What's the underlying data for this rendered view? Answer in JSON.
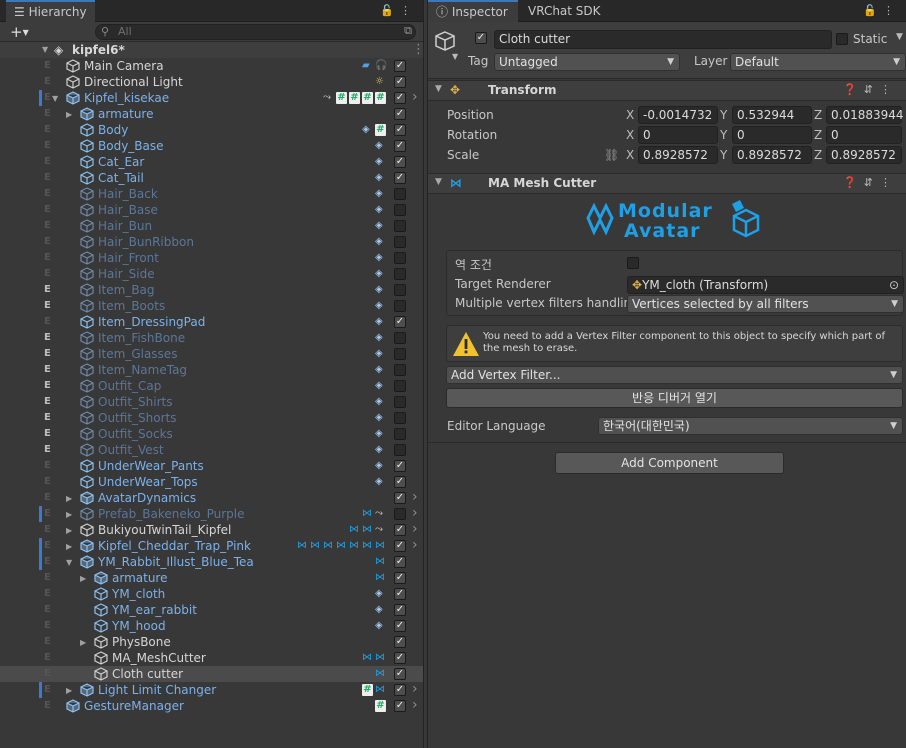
{
  "hierarchy": {
    "tab": "Hierarchy",
    "search_placeholder": "All",
    "scene": "kipfel6*",
    "rows": [
      {
        "label": "Main Camera",
        "color": "white",
        "depth": 0,
        "icons": [
          "camera-icon",
          "audio-listener-icon"
        ],
        "chk": true
      },
      {
        "label": "Directional Light",
        "color": "white",
        "depth": 0,
        "icons": [
          "light-icon"
        ],
        "chk": true
      },
      {
        "label": "Kipfel_kisekae",
        "color": "blue",
        "depth": 0,
        "arrow": "down",
        "bar": true,
        "icons": [
          "constraint-icon",
          "script-icon",
          "script-icon",
          "script-icon",
          "script-icon"
        ],
        "chk": true,
        "more": true
      },
      {
        "label": "armature",
        "color": "blue",
        "depth": 1,
        "arrow": "right",
        "chk": true
      },
      {
        "label": "Body",
        "color": "blue",
        "depth": 1,
        "icons": [
          "mesh-renderer-icon",
          "script-icon"
        ],
        "chk": true
      },
      {
        "label": "Body_Base",
        "color": "blue",
        "depth": 1,
        "icons": [
          "mesh-renderer-icon"
        ],
        "chk": true
      },
      {
        "label": "Cat_Ear",
        "color": "blue",
        "depth": 1,
        "icons": [
          "mesh-renderer-icon"
        ],
        "chk": true
      },
      {
        "label": "Cat_Tail",
        "color": "blue",
        "depth": 1,
        "icons": [
          "mesh-renderer-icon"
        ],
        "chk": true
      },
      {
        "label": "Hair_Back",
        "color": "dim",
        "depth": 1,
        "icons": [
          "mesh-renderer-icon"
        ],
        "chk": false
      },
      {
        "label": "Hair_Base",
        "color": "dim",
        "depth": 1,
        "icons": [
          "mesh-renderer-icon"
        ],
        "chk": false
      },
      {
        "label": "Hair_Bun",
        "color": "dim",
        "depth": 1,
        "icons": [
          "mesh-renderer-icon"
        ],
        "chk": false
      },
      {
        "label": "Hair_BunRibbon",
        "color": "dim",
        "depth": 1,
        "icons": [
          "mesh-renderer-icon"
        ],
        "chk": false
      },
      {
        "label": "Hair_Front",
        "color": "dim",
        "depth": 1,
        "icons": [
          "mesh-renderer-icon"
        ],
        "chk": false
      },
      {
        "label": "Hair_Side",
        "color": "dim",
        "depth": 1,
        "icons": [
          "mesh-renderer-icon"
        ],
        "chk": false
      },
      {
        "label": "Item_Bag",
        "color": "dim",
        "depth": 1,
        "e": true,
        "icons": [
          "mesh-renderer-icon"
        ],
        "chk": false
      },
      {
        "label": "Item_Boots",
        "color": "dim",
        "depth": 1,
        "e": true,
        "icons": [
          "mesh-renderer-icon"
        ],
        "chk": false
      },
      {
        "label": "Item_DressingPad",
        "color": "blue",
        "depth": 1,
        "icons": [
          "mesh-renderer-icon"
        ],
        "chk": true
      },
      {
        "label": "Item_FishBone",
        "color": "dim",
        "depth": 1,
        "e": true,
        "icons": [
          "mesh-renderer-icon"
        ],
        "chk": false
      },
      {
        "label": "Item_Glasses",
        "color": "dim",
        "depth": 1,
        "e": true,
        "icons": [
          "mesh-renderer-icon"
        ],
        "chk": false
      },
      {
        "label": "Item_NameTag",
        "color": "dim",
        "depth": 1,
        "e": true,
        "icons": [
          "mesh-renderer-icon"
        ],
        "chk": false
      },
      {
        "label": "Outfit_Cap",
        "color": "dim",
        "depth": 1,
        "e": true,
        "icons": [
          "mesh-renderer-icon"
        ],
        "chk": false
      },
      {
        "label": "Outfit_Shirts",
        "color": "dim",
        "depth": 1,
        "e": true,
        "icons": [
          "mesh-renderer-icon"
        ],
        "chk": false
      },
      {
        "label": "Outfit_Shorts",
        "color": "dim",
        "depth": 1,
        "e": true,
        "icons": [
          "mesh-renderer-icon"
        ],
        "chk": false
      },
      {
        "label": "Outfit_Socks",
        "color": "dim",
        "depth": 1,
        "e": true,
        "icons": [
          "mesh-renderer-icon"
        ],
        "chk": false
      },
      {
        "label": "Outfit_Vest",
        "color": "dim",
        "depth": 1,
        "e": true,
        "icons": [
          "mesh-renderer-icon"
        ],
        "chk": false
      },
      {
        "label": "UnderWear_Pants",
        "color": "blue",
        "depth": 1,
        "icons": [
          "mesh-renderer-icon"
        ],
        "chk": true
      },
      {
        "label": "UnderWear_Tops",
        "color": "blue",
        "depth": 1,
        "icons": [
          "mesh-renderer-icon"
        ],
        "chk": true
      },
      {
        "label": "AvatarDynamics",
        "color": "blue",
        "depth": 1,
        "arrow": "right",
        "chk": true,
        "more": true
      },
      {
        "label": "Prefab_Bakeneko_Purple",
        "color": "dim",
        "depth": 1,
        "arrow": "right",
        "bar": true,
        "icons": [
          "modular-avatar-icon",
          "constraint-icon"
        ],
        "chk": false,
        "more": true
      },
      {
        "label": "BukiyouTwinTail_Kipfel",
        "color": "white",
        "depth": 1,
        "arrow": "right",
        "icons": [
          "modular-avatar-icon",
          "modular-avatar-icon",
          "constraint-icon"
        ],
        "chk": true,
        "more": true
      },
      {
        "label": "Kipfel_Cheddar_Trap_Pink",
        "color": "blue",
        "depth": 1,
        "arrow": "right",
        "bar": true,
        "icons": [
          "modular-avatar-icon",
          "modular-avatar-icon",
          "modular-avatar-icon",
          "modular-avatar-icon",
          "modular-avatar-icon",
          "modular-avatar-icon",
          "modular-avatar-icon"
        ],
        "chk": true,
        "more": true
      },
      {
        "label": "YM_Rabbit_Illust_Blue_Tea",
        "color": "blue",
        "depth": 1,
        "arrow": "down",
        "bar": true,
        "icons": [
          "modular-avatar-icon"
        ],
        "chk": true
      },
      {
        "label": "armature",
        "color": "blue",
        "depth": 2,
        "arrow": "right",
        "icons": [
          "modular-avatar-icon"
        ],
        "chk": true
      },
      {
        "label": "YM_cloth",
        "color": "blue",
        "depth": 2,
        "icons": [
          "mesh-renderer-icon"
        ],
        "chk": true
      },
      {
        "label": "YM_ear_rabbit",
        "color": "blue",
        "depth": 2,
        "icons": [
          "mesh-renderer-icon"
        ],
        "chk": true
      },
      {
        "label": "YM_hood",
        "color": "blue",
        "depth": 2,
        "icons": [
          "mesh-renderer-icon"
        ],
        "chk": true
      },
      {
        "label": "PhysBone",
        "color": "white",
        "depth": 2,
        "arrow": "right",
        "chk": true
      },
      {
        "label": "MA_MeshCutter",
        "color": "white",
        "depth": 2,
        "icons": [
          "modular-avatar-icon",
          "modular-avatar-icon"
        ],
        "chk": true
      },
      {
        "label": "Cloth cutter",
        "color": "white",
        "depth": 2,
        "selected": true,
        "icons": [
          "modular-avatar-icon"
        ],
        "chk": true
      },
      {
        "label": "Light Limit Changer",
        "color": "blue",
        "depth": 1,
        "arrow": "right",
        "bar": true,
        "icons": [
          "script-icon",
          "modular-avatar-icon"
        ],
        "chk": true,
        "more": true
      },
      {
        "label": "GestureManager",
        "color": "blue",
        "depth": 0,
        "icons": [
          "script-icon"
        ],
        "chk": true,
        "more": true
      }
    ]
  },
  "inspector": {
    "tabs": [
      "Inspector",
      "VRChat SDK"
    ],
    "object_name": "Cloth cutter",
    "static_label": "Static",
    "tag_label": "Tag",
    "tag_value": "Untagged",
    "layer_label": "Layer",
    "layer_value": "Default",
    "transform": {
      "title": "Transform",
      "position_label": "Position",
      "rotation_label": "Rotation",
      "scale_label": "Scale",
      "axes": [
        "X",
        "Y",
        "Z"
      ],
      "position": [
        "-0.0014732",
        "0.532944",
        "0.01883944"
      ],
      "rotation": [
        "0",
        "0",
        "0"
      ],
      "scale": [
        "0.8928572",
        "0.8928572",
        "0.8928572"
      ]
    },
    "mesh_cutter": {
      "title": "MA Mesh Cutter",
      "logo_line1": "Modular",
      "logo_line2": "Avatar",
      "invert_label": "역 조건",
      "target_label": "Target Renderer",
      "target_value": "YM_cloth (Transform)",
      "multi_label": "Multiple vertex filters handling",
      "multi_value": "Vertices selected by all filters",
      "warning": "You need to add a Vertex Filter component to this object to specify which part of the mesh to erase.",
      "add_filter": "Add Vertex Filter...",
      "debugger": "반응 디버거 열기",
      "lang_label": "Editor Language",
      "lang_value": "한국어(대한민국)"
    },
    "add_component": "Add Component"
  },
  "colors": {
    "blue": "#7cb1ea",
    "dim": "#5b7698",
    "white": "#d6d6d6",
    "accent": "#3b7ad4",
    "ma_blue": "#1e9fe6"
  }
}
